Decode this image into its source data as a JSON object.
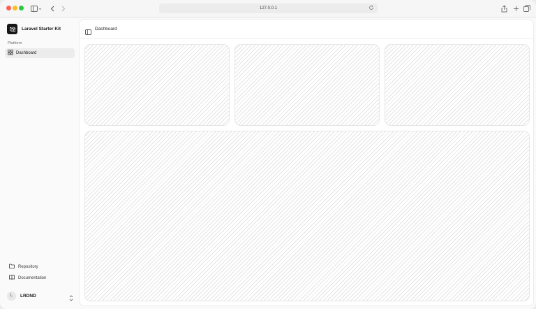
{
  "browser": {
    "url": "127.0.0.1",
    "icons": {
      "sidebar_toggle": "sidebar-icon",
      "back": "chevron-left-icon",
      "forward": "chevron-right-icon",
      "reload": "reload-icon",
      "share": "share-icon",
      "new_tab": "plus-icon",
      "tabs": "tabs-icon"
    }
  },
  "sidebar": {
    "brand": "Laravel Starter Kit",
    "section_label": "Platform",
    "nav": [
      {
        "label": "Dashboard",
        "icon": "grid-icon",
        "active": true
      }
    ],
    "footer_links": [
      {
        "label": "Repository",
        "icon": "folder-icon"
      },
      {
        "label": "Documentation",
        "icon": "book-icon"
      }
    ],
    "user": {
      "initial": "L",
      "name": "LRDND"
    }
  },
  "main": {
    "breadcrumb": "Dashboard"
  },
  "colors": {
    "accent": "#161616",
    "traffic_close": "#fe5f57",
    "traffic_min": "#febc2e",
    "traffic_max": "#28c840"
  }
}
